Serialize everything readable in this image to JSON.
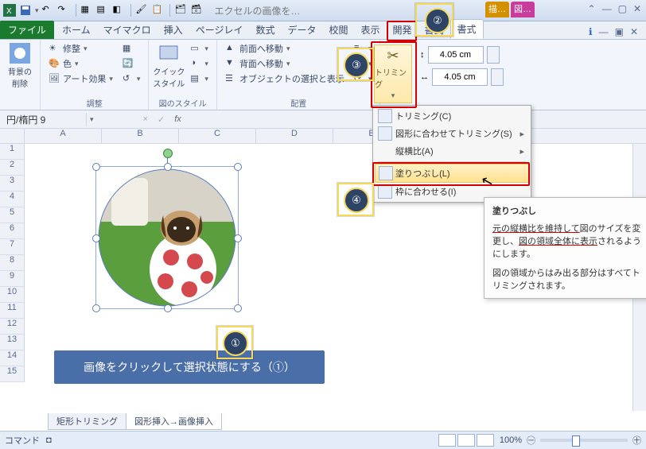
{
  "title": "エクセルの画像を…",
  "contextTabs": {
    "draw": "描…",
    "pic": "図…"
  },
  "tabs": {
    "file": "ファイル",
    "home": "ホーム",
    "mymacro": "マイマクロ",
    "insert": "挿入",
    "pagelayout": "ページレイ",
    "formulas": "数式",
    "data": "データ",
    "review": "校閲",
    "view": "表示",
    "dev": "開発",
    "format1": "書式",
    "format2": "書式"
  },
  "ribbon": {
    "removeBg": "背景の\n削除",
    "adjust": {
      "fix": "修整",
      "color": "色",
      "art": "アート効果",
      "group": "調整"
    },
    "quickStyle": "クイック\nスタイル",
    "styleGroup": "図のスタイル",
    "arrange": {
      "front": "前面へ移動",
      "back": "背面へ移動",
      "select": "オブジェクトの選択と表示",
      "group": "配置"
    },
    "trimming": "トリミング",
    "size": {
      "h": "4.05 cm",
      "w": "4.05 cm"
    }
  },
  "namebox": "円/楕円 9",
  "cols": [
    "A",
    "B",
    "C",
    "D",
    "E"
  ],
  "rows": [
    "1",
    "2",
    "3",
    "4",
    "5",
    "6",
    "7",
    "8",
    "9",
    "10",
    "11",
    "12",
    "13",
    "14",
    "15"
  ],
  "dropdown": {
    "trim": "トリミング(C)",
    "shape": "図形に合わせてトリミング(S)",
    "aspect": "縦横比(A)",
    "fill": "塗りつぶし(L)",
    "fit": "枠に合わせる(I)"
  },
  "tooltip": {
    "title": "塗りつぶし",
    "p1a": "元の縦横比を維持して",
    "p1b": "図のサイズを変更し、",
    "p1c": "図の領域全体に表示",
    "p1d": "されるようにします。",
    "p2": "図の領域からはみ出る部分はすべてトリミングされます。"
  },
  "bluebar": "画像をクリックして選択状態にする（①）",
  "sheets": {
    "s1": "矩形トリミング",
    "s2": "図形挿入→画像挿入"
  },
  "status": {
    "cmd": "コマンド",
    "zoom": "100%"
  },
  "badges": {
    "b1": "①",
    "b2": "②",
    "b3": "③",
    "b4": "④"
  }
}
